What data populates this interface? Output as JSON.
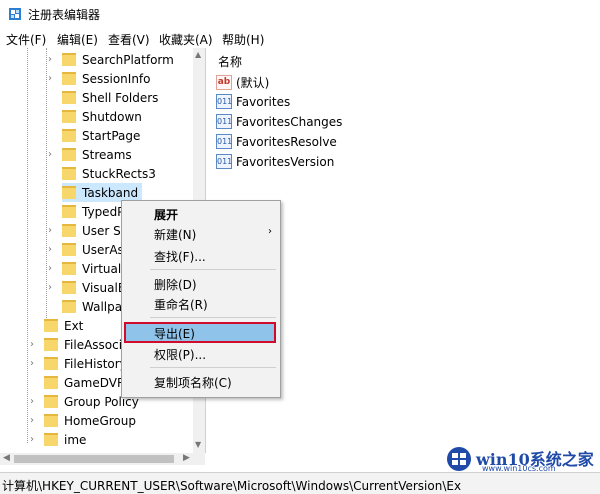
{
  "window": {
    "title": "注册表编辑器"
  },
  "menu": [
    {
      "label": "文件(F)"
    },
    {
      "label": "编辑(E)"
    },
    {
      "label": "查看(V)"
    },
    {
      "label": "收藏夹(A)"
    },
    {
      "label": "帮助(H)"
    }
  ],
  "tree": {
    "items": [
      {
        "label": "SearchPlatform"
      },
      {
        "label": "SessionInfo"
      },
      {
        "label": "Shell Folders"
      },
      {
        "label": "Shutdown"
      },
      {
        "label": "StartPage"
      },
      {
        "label": "Streams"
      },
      {
        "label": "StuckRects3"
      },
      {
        "label": "Taskband"
      },
      {
        "label": "TypedP"
      },
      {
        "label": "User Sh"
      },
      {
        "label": "UserAs"
      },
      {
        "label": "VirtualD"
      },
      {
        "label": "VisualE"
      },
      {
        "label": "Wallpa"
      },
      {
        "label": "Ext"
      },
      {
        "label": "FileAssocia"
      },
      {
        "label": "FileHistory"
      },
      {
        "label": "GameDVR"
      },
      {
        "label": "Group Policy"
      },
      {
        "label": "HomeGroup"
      },
      {
        "label": "ime"
      }
    ]
  },
  "values": {
    "header": "名称",
    "rows": [
      {
        "icon": "ab",
        "label": "(默认)"
      },
      {
        "icon": "reg",
        "label": "Favorites"
      },
      {
        "icon": "reg",
        "label": "FavoritesChanges"
      },
      {
        "icon": "reg",
        "label": "FavoritesResolve"
      },
      {
        "icon": "reg",
        "label": "FavoritesVersion"
      }
    ]
  },
  "context_menu": {
    "items": [
      {
        "label": "展开"
      },
      {
        "label": "新建(N)"
      },
      {
        "label": "查找(F)..."
      },
      {
        "label": "删除(D)"
      },
      {
        "label": "重命名(R)"
      },
      {
        "label": "导出(E)"
      },
      {
        "label": "权限(P)..."
      },
      {
        "label": "复制项名称(C)"
      }
    ],
    "submenu_arrow": "›"
  },
  "status": {
    "path": "计算机\\HKEY_CURRENT_USER\\Software\\Microsoft\\Windows\\CurrentVersion\\Ex"
  },
  "watermark": {
    "text": "win10系统之家",
    "sub": "www.win10cs.com"
  },
  "colors": {
    "selection": "#cce8ff",
    "menu_highlight": "#8fc3ea",
    "highlight_border": "#d10b2b"
  }
}
